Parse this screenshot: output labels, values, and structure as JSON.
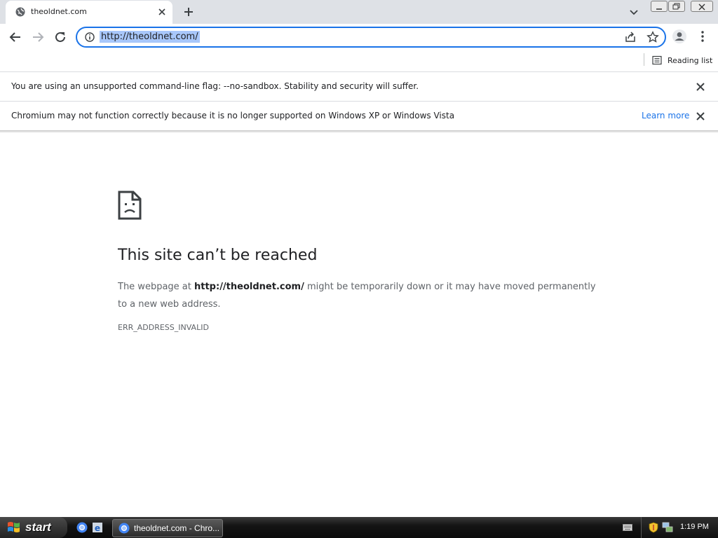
{
  "tab": {
    "title": "theoldnet.com"
  },
  "omnibox": {
    "url": "http://theoldnet.com/"
  },
  "bookmarks": {
    "reading_list_label": "Reading list"
  },
  "infobars": [
    {
      "message": "You are using an unsupported command-line flag: --no-sandbox. Stability and security will suffer."
    },
    {
      "message": "Chromium may not function correctly because it is no longer supported on Windows XP or Windows Vista",
      "link": "Learn more"
    }
  ],
  "error": {
    "title": "This site can’t be reached",
    "desc_prefix": "The webpage at ",
    "desc_url": "http://theoldnet.com/",
    "desc_suffix": " might be temporarily down or it may have moved permanently to a new web address.",
    "code": "ERR_ADDRESS_INVALID"
  },
  "taskbar": {
    "start_label": "start",
    "task_label": "theoldnet.com - Chro...",
    "clock": "1:19 PM"
  },
  "colors": {
    "accent": "#1a73e8",
    "tabstrip": "#dee1e6",
    "taskbar": "#141414"
  }
}
